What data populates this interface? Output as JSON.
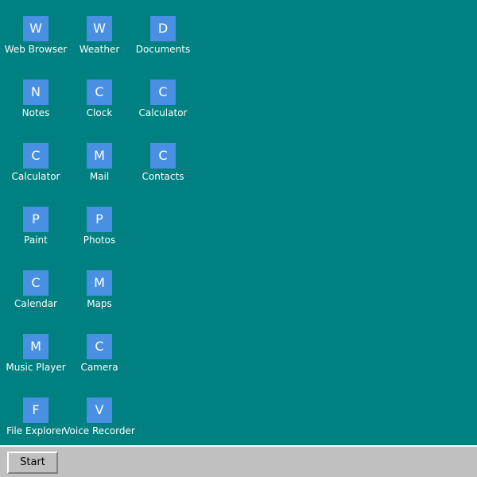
{
  "desktop": {
    "background_color": "#008080",
    "icon_color": "#4a90e2",
    "icons": [
      {
        "glyph": "W",
        "label": "Web Browser"
      },
      {
        "glyph": "W",
        "label": "Weather"
      },
      {
        "glyph": "D",
        "label": "Documents"
      },
      {
        "glyph": "N",
        "label": "Notes"
      },
      {
        "glyph": "C",
        "label": "Clock"
      },
      {
        "glyph": "C",
        "label": "Calculator"
      },
      {
        "glyph": "C",
        "label": "Calculator"
      },
      {
        "glyph": "M",
        "label": "Mail"
      },
      {
        "glyph": "C",
        "label": "Contacts"
      },
      {
        "glyph": "P",
        "label": "Paint"
      },
      {
        "glyph": "P",
        "label": "Photos"
      },
      {
        "glyph": "C",
        "label": "Calendar"
      },
      {
        "glyph": "M",
        "label": "Maps"
      },
      {
        "glyph": "M",
        "label": "Music Player"
      },
      {
        "glyph": "C",
        "label": "Camera"
      },
      {
        "glyph": "F",
        "label": "File Explorer"
      },
      {
        "glyph": "V",
        "label": "Voice Recorder"
      }
    ]
  },
  "taskbar": {
    "background_color": "#c0c0c0",
    "start_label": "Start"
  }
}
